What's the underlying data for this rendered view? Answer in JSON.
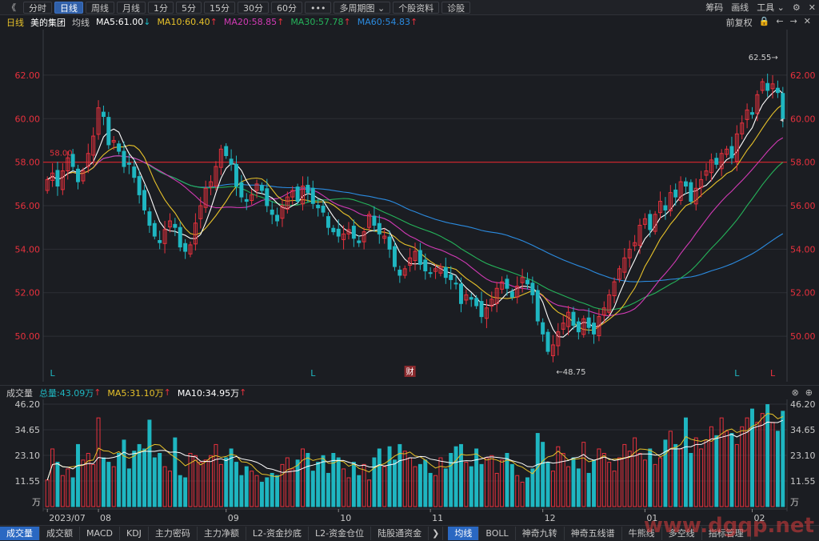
{
  "toolbar": {
    "back": "《",
    "tabs": [
      "分时",
      "日线",
      "周线",
      "月线",
      "1分",
      "5分",
      "15分",
      "30分",
      "60分",
      "•••",
      "多周期图 ⌄",
      "个股资料",
      "诊股"
    ],
    "active_tab": 1,
    "right": [
      "筹码",
      "画线",
      "工具 ⌄"
    ]
  },
  "info": {
    "period": "日线",
    "stock": "美的集团",
    "ma_label": "均线",
    "ma5": "MA5:61.00",
    "ma10": "MA10:60.40",
    "ma20": "MA20:58.85",
    "ma30": "MA30:57.78",
    "ma60": "MA60:54.83",
    "fuquan": "前复权"
  },
  "volume_info": {
    "label": "成交量",
    "total": "总量:43.09万",
    "ma5": "MA5:31.10万",
    "ma10": "MA10:34.95万"
  },
  "colors": {
    "up": "#e8313d",
    "down": "#1fb6c1",
    "ma5": "#ffffff",
    "ma10": "#e6c12a",
    "ma20": "#d23ab5",
    "ma30": "#25b35a",
    "ma60": "#2b8be0",
    "grid": "#2c2f35",
    "ref": "#c6262c"
  },
  "bottom_tabs_left": [
    "成交量",
    "成交额",
    "MACD",
    "KDJ",
    "主力密码",
    "主力净额",
    "L2-资金抄底",
    "L2-资金仓位",
    "陆股通资金"
  ],
  "bottom_tabs_right": [
    "均线",
    "BOLL",
    "神奇九转",
    "神奇五线谱",
    "牛熊线",
    "多空线",
    "指标管理"
  ],
  "watermark": "www.dgqp.net",
  "chart_data": {
    "type": "candlestick",
    "price_axis_ticks": [
      "62.00",
      "60.00",
      "58.00",
      "56.00",
      "54.00",
      "52.00",
      "50.00"
    ],
    "price_ylim": [
      48.2,
      63.8
    ],
    "volume_axis_ticks": [
      "46.20",
      "34.65",
      "23.10",
      "11.55"
    ],
    "volume_unit": "万",
    "volume_ylim": [
      0,
      46.2
    ],
    "x_labels": [
      {
        "text": "2023/07",
        "index": 0
      },
      {
        "text": "08",
        "index": 10
      },
      {
        "text": "09",
        "index": 35
      },
      {
        "text": "10",
        "index": 57
      },
      {
        "text": "11",
        "index": 75
      },
      {
        "text": "12",
        "index": 97
      },
      {
        "text": "01",
        "index": 117
      },
      {
        "text": "02",
        "index": 138
      }
    ],
    "reference_line": {
      "value": 58.0,
      "label": "58.00"
    },
    "high_marker": {
      "value": 62.55,
      "label": "62.55→",
      "index": 144
    },
    "low_marker": {
      "value": 48.75,
      "label": "←48.75",
      "index": 99
    },
    "markers": [
      {
        "text": "L",
        "index": 1,
        "color": "#1fb6c1"
      },
      {
        "text": "L",
        "index": 52,
        "color": "#1fb6c1"
      },
      {
        "text": "财",
        "index": 71,
        "color": "#e8313d"
      },
      {
        "text": "L",
        "index": 135,
        "color": "#1fb6c1"
      },
      {
        "text": "L",
        "index": 142,
        "color": "#e8313d"
      }
    ],
    "close": [
      57.2,
      57.5,
      56.9,
      57.6,
      58.2,
      57.8,
      57.1,
      57.6,
      58.4,
      59.2,
      60.5,
      60.1,
      58.8,
      59.0,
      58.5,
      57.8,
      57.9,
      57.3,
      56.5,
      55.8,
      55.1,
      54.6,
      54.3,
      54.9,
      55.3,
      55.0,
      54.1,
      53.9,
      54.2,
      55.2,
      56.0,
      56.8,
      57.1,
      57.8,
      58.6,
      58.3,
      57.9,
      56.9,
      56.4,
      56.2,
      56.5,
      57.0,
      56.7,
      56.0,
      55.6,
      55.3,
      56.0,
      56.4,
      56.7,
      56.2,
      56.9,
      56.6,
      56.1,
      55.9,
      55.7,
      55.0,
      54.8,
      54.6,
      54.7,
      54.9,
      54.5,
      54.3,
      54.8,
      55.6,
      55.1,
      54.7,
      54.6,
      54.0,
      53.2,
      52.8,
      53.1,
      53.6,
      53.9,
      53.3,
      53.0,
      52.9,
      53.1,
      53.2,
      52.7,
      52.6,
      52.4,
      51.5,
      51.9,
      51.7,
      51.4,
      50.9,
      51.3,
      51.7,
      52.2,
      52.5,
      52.2,
      51.8,
      52.3,
      52.7,
      52.4,
      51.9,
      50.7,
      50.1,
      49.3,
      49.6,
      50.2,
      50.6,
      51.1,
      50.5,
      50.2,
      50.8,
      50.4,
      50.1,
      50.9,
      51.3,
      51.9,
      52.5,
      53.1,
      53.6,
      54.0,
      54.3,
      55.1,
      55.4,
      54.9,
      55.6,
      56.2,
      55.8,
      56.6,
      56.4,
      57.1,
      56.9,
      56.2,
      56.8,
      57.2,
      57.6,
      58.1,
      57.9,
      58.4,
      58.6,
      58.2,
      59.3,
      59.8,
      60.4,
      60.2,
      61.1,
      61.7,
      61.3,
      61.6,
      61.2,
      60.0
    ],
    "volume": [
      12,
      26,
      20,
      14,
      17,
      13,
      28,
      21,
      24,
      19,
      40,
      22,
      20,
      18,
      24,
      30,
      17,
      25,
      28,
      26,
      39,
      22,
      24,
      18,
      16,
      31,
      14,
      13,
      24,
      23,
      20,
      21,
      23,
      28,
      19,
      22,
      26,
      20,
      14,
      18,
      16,
      14,
      11,
      13,
      15,
      14,
      19,
      22,
      17,
      21,
      26,
      24,
      16,
      20,
      23,
      15,
      24,
      22,
      17,
      13,
      20,
      14,
      19,
      12,
      22,
      26,
      18,
      27,
      21,
      28,
      25,
      22,
      18,
      19,
      21,
      15,
      14,
      22,
      17,
      24,
      27,
      28,
      20,
      18,
      26,
      19,
      22,
      23,
      15,
      21,
      24,
      19,
      14,
      11,
      13,
      17,
      33,
      29,
      20,
      16,
      27,
      24,
      18,
      22,
      17,
      29,
      15,
      21,
      26,
      24,
      20,
      16,
      22,
      28,
      25,
      31,
      24,
      21,
      26,
      19,
      22,
      30,
      34,
      28,
      26,
      40,
      24,
      31,
      26,
      30,
      36,
      32,
      40,
      34,
      33,
      28,
      36,
      40,
      44,
      38,
      42,
      46,
      38,
      34,
      43
    ]
  }
}
